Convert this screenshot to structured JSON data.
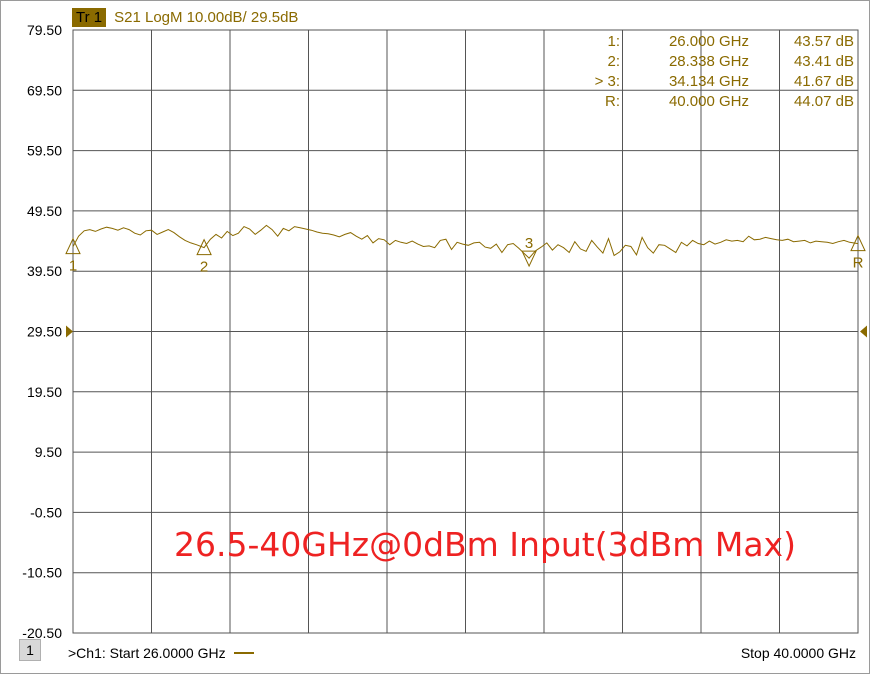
{
  "header": {
    "trace_tag": "Tr 1",
    "trace_desc": "S21 LogM 10.00dB/  29.5dB"
  },
  "markers_table": [
    {
      "label": "1:",
      "freq": "26.000 GHz",
      "value": "43.57 dB"
    },
    {
      "label": "2:",
      "freq": "28.338 GHz",
      "value": "43.41 dB"
    },
    {
      "label": "> 3:",
      "freq": "34.134 GHz",
      "value": "41.67 dB"
    },
    {
      "label": "R:",
      "freq": "40.000 GHz",
      "value": "44.07 dB"
    }
  ],
  "footer": {
    "channel_index": "1",
    "start": ">Ch1: Start  26.0000 GHz",
    "stop": "Stop  40.0000 GHz"
  },
  "annotation": "26.5-40GHz@0dBm Input(3dBm Max)",
  "colors": {
    "trace": "#8a6a00",
    "grid": "#555555",
    "annotation": "#ee2222"
  },
  "chart_data": {
    "type": "line",
    "x_unit": "GHz",
    "y_unit": "dB",
    "xlim": [
      26.0,
      40.0
    ],
    "ylim": [
      -20.5,
      79.5
    ],
    "y_ticks": [
      79.5,
      69.5,
      59.5,
      49.5,
      39.5,
      29.5,
      19.5,
      9.5,
      -0.5,
      -10.5,
      -20.5
    ],
    "y_tick_labels": [
      "79.50",
      "69.50",
      "59.50",
      "49.50",
      "39.50",
      "29.50",
      "19.50",
      "9.50",
      "-0.50",
      "-10.50",
      "-20.50"
    ],
    "reference_level": 29.5,
    "grid": true,
    "series": [
      {
        "x": [
          26.0,
          26.1,
          26.2,
          26.3,
          26.4,
          26.5,
          26.6,
          26.7,
          26.8,
          26.9,
          27.0,
          27.1,
          27.2,
          27.3,
          27.4,
          27.5,
          27.6,
          27.7,
          27.8,
          27.9,
          28.0,
          28.1,
          28.2,
          28.338,
          28.45,
          28.55,
          28.65,
          28.75,
          28.85,
          28.95,
          29.05,
          29.15,
          29.25,
          29.35,
          29.45,
          29.55,
          29.65,
          29.75,
          29.85,
          29.95,
          30.05,
          30.15,
          30.25,
          30.35,
          30.45,
          30.55,
          30.65,
          30.75,
          30.85,
          30.95,
          31.05,
          31.15,
          31.25,
          31.35,
          31.45,
          31.55,
          31.65,
          31.75,
          31.85,
          31.95,
          32.05,
          32.15,
          32.25,
          32.35,
          32.45,
          32.55,
          32.65,
          32.75,
          32.85,
          32.95,
          33.05,
          33.15,
          33.25,
          33.35,
          33.45,
          33.55,
          33.65,
          33.75,
          33.85,
          33.95,
          34.05,
          34.134,
          34.25,
          34.35,
          34.45,
          34.55,
          34.65,
          34.75,
          34.85,
          34.95,
          35.05,
          35.15,
          35.25,
          35.35,
          35.45,
          35.55,
          35.65,
          35.75,
          35.85,
          35.95,
          36.05,
          36.15,
          36.25,
          36.35,
          36.45,
          36.55,
          36.65,
          36.75,
          36.85,
          36.95,
          37.05,
          37.15,
          37.25,
          37.35,
          37.45,
          37.55,
          37.65,
          37.75,
          37.85,
          37.95,
          38.05,
          38.15,
          38.25,
          38.35,
          38.45,
          38.55,
          38.65,
          38.75,
          38.85,
          38.95,
          39.05,
          39.15,
          39.25,
          39.35,
          39.45,
          39.55,
          39.65,
          39.75,
          39.85,
          40.0
        ],
        "values": [
          43.57,
          45.3,
          46.2,
          46.4,
          46.1,
          46.5,
          46.8,
          46.6,
          46.3,
          46.7,
          46.4,
          45.8,
          45.5,
          46.2,
          46.3,
          45.6,
          46.0,
          46.4,
          45.9,
          45.2,
          44.6,
          44.2,
          43.9,
          43.41,
          44.8,
          45.6,
          45.0,
          46.1,
          45.4,
          45.8,
          46.9,
          46.5,
          45.6,
          46.3,
          47.1,
          46.4,
          45.3,
          46.6,
          46.2,
          46.9,
          46.7,
          46.5,
          46.3,
          46.0,
          45.8,
          45.7,
          45.5,
          45.2,
          45.6,
          45.9,
          45.3,
          44.8,
          45.4,
          44.2,
          44.9,
          44.7,
          43.9,
          44.6,
          44.3,
          44.1,
          44.5,
          44.0,
          43.6,
          43.7,
          43.4,
          44.6,
          44.8,
          43.1,
          44.3,
          44.0,
          43.8,
          44.2,
          44.3,
          43.5,
          43.3,
          44.0,
          42.6,
          43.9,
          44.1,
          43.3,
          42.4,
          41.67,
          42.9,
          43.5,
          44.2,
          43.0,
          43.9,
          43.4,
          42.6,
          44.4,
          43.2,
          42.8,
          44.6,
          43.5,
          42.5,
          44.9,
          42.1,
          42.7,
          43.8,
          43.6,
          42.2,
          45.1,
          43.4,
          42.5,
          43.9,
          43.8,
          43.2,
          42.6,
          44.3,
          43.7,
          44.6,
          44.1,
          43.9,
          44.5,
          44.0,
          44.3,
          44.7,
          44.5,
          44.6,
          44.4,
          45.3,
          44.7,
          44.8,
          45.1,
          44.9,
          44.7,
          44.6,
          44.8,
          44.4,
          44.5,
          44.6,
          44.2,
          44.5,
          44.4,
          44.3,
          44.1,
          44.4,
          44.6,
          44.3,
          44.07
        ]
      }
    ],
    "markers": [
      {
        "label": "1",
        "x": 26.0,
        "y": 43.57,
        "shape": "triangle-up",
        "label_pos": "below"
      },
      {
        "label": "2",
        "x": 28.338,
        "y": 43.41,
        "shape": "triangle-up",
        "label_pos": "below"
      },
      {
        "label": "3",
        "x": 34.134,
        "y": 41.67,
        "shape": "triangle-down",
        "label_pos": "above"
      },
      {
        "label": "R",
        "x": 40.0,
        "y": 44.07,
        "shape": "triangle-up",
        "label_pos": "below"
      }
    ]
  }
}
